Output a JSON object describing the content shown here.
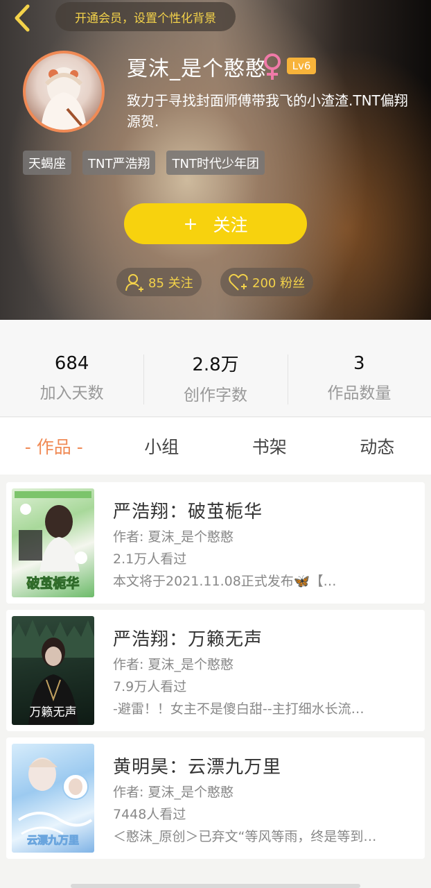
{
  "header": {
    "vip_banner": "开通会员，设置个性化背景",
    "username": "夏沫_是个憨憨",
    "level": "Lv6",
    "bio": "致力于寻找封面师傅带我飞的小渣渣.TNT偏翔源贺.",
    "tags": [
      "天蝎座",
      "TNT严浩翔",
      "TNT时代少年团"
    ],
    "follow_plus": "+",
    "follow_label": "关注",
    "following": "85 关注",
    "fans": "200 粉丝"
  },
  "stats": [
    {
      "value": "684",
      "label": "加入天数"
    },
    {
      "value": "2.8万",
      "label": "创作字数"
    },
    {
      "value": "3",
      "label": "作品数量"
    }
  ],
  "tabs": [
    "- 作品 -",
    "小组",
    "书架",
    "动态"
  ],
  "works": [
    {
      "title": "严浩翔：破茧栀华",
      "author": "作者: 夏沫_是个憨憨",
      "views": "2.1万人看过",
      "desc": "本文将于2021.11.08正式发布🦋【…",
      "cover_text": "破茧栀华"
    },
    {
      "title": "严浩翔：万籁无声",
      "author": "作者: 夏沫_是个憨憨",
      "views": "7.9万人看过",
      "desc": "-避雷！！女主不是傻白甜--主打细水长流…",
      "cover_text": "万籁无声"
    },
    {
      "title": "黄明昊：云漂九万里",
      "author": "作者: 夏沫_是个憨憨",
      "views": "7448人看过",
      "desc": "＜憨沫_原创＞已弃文“等风等雨，终是等到…",
      "cover_text": "云漂九万里"
    }
  ],
  "colors": {
    "accent_yellow": "#f7d20e",
    "accent_orange": "#f08a55",
    "female_pink": "#f07aa8",
    "level_badge": "#f7b33a"
  }
}
